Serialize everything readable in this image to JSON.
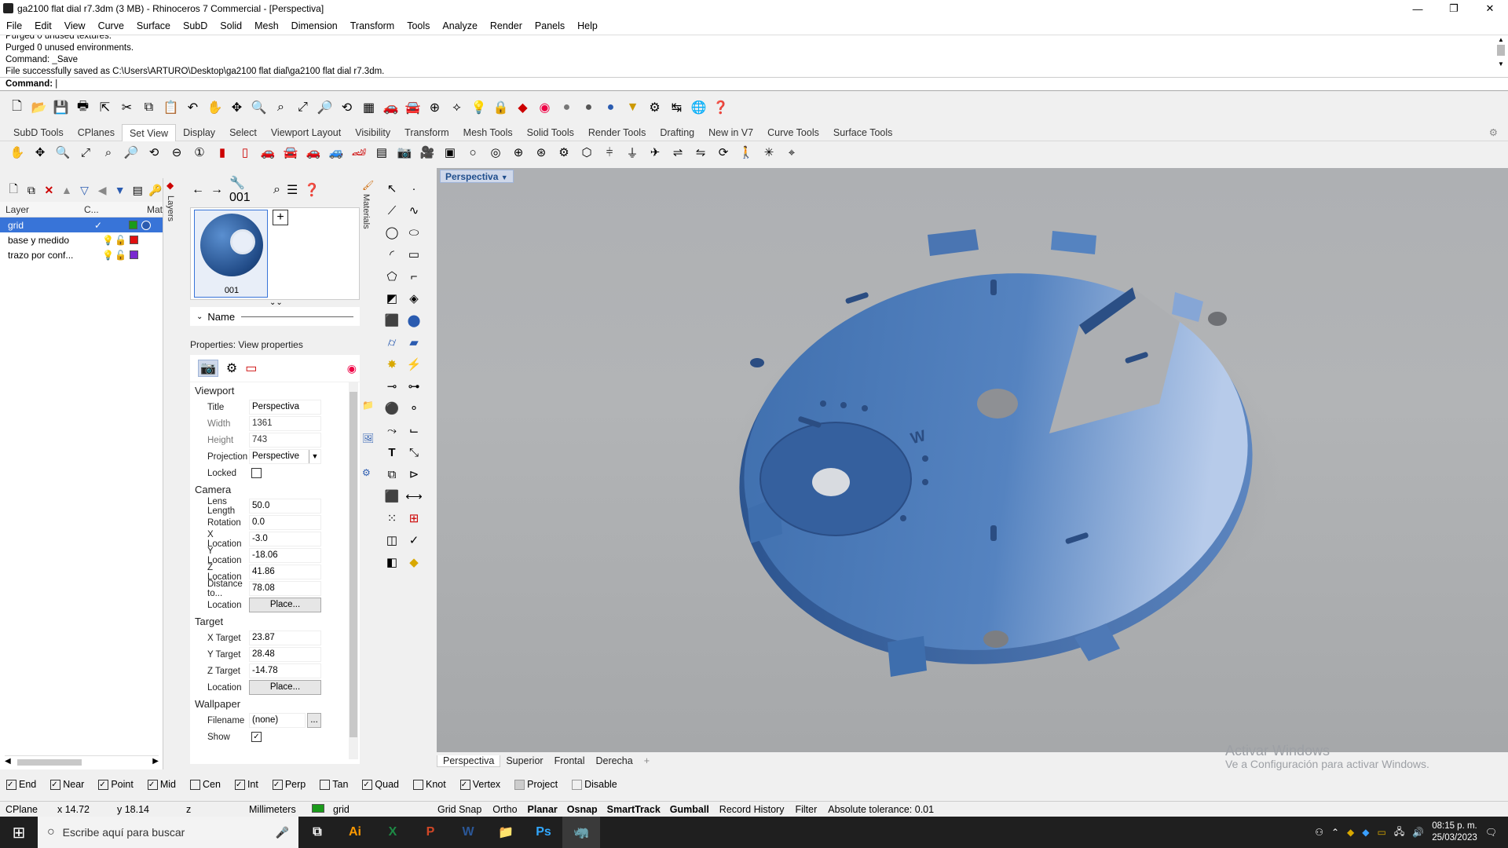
{
  "window": {
    "title": "ga2100 flat dial r7.3dm (3 MB) - Rhinoceros 7 Commercial - [Perspectiva]"
  },
  "menu": [
    "File",
    "Edit",
    "View",
    "Curve",
    "Surface",
    "SubD",
    "Solid",
    "Mesh",
    "Dimension",
    "Transform",
    "Tools",
    "Analyze",
    "Render",
    "Panels",
    "Help"
  ],
  "command_history": [
    "Purged 0 unused textures.",
    "Purged 0 unused environments.",
    "Command: _Save",
    "File successfully saved as C:\\Users\\ARTURO\\Desktop\\ga2100 flat dial\\ga2100 flat dial r7.3dm."
  ],
  "command_prompt": "Command:",
  "toolbar_tabs": [
    "SubD Tools",
    "CPlanes",
    "Set View",
    "Display",
    "Select",
    "Viewport Layout",
    "Visibility",
    "Transform",
    "Mesh Tools",
    "Solid Tools",
    "Render Tools",
    "Drafting",
    "New in V7",
    "Curve Tools",
    "Surface Tools"
  ],
  "active_toolbar_tab": "Set View",
  "layers": {
    "columns": [
      "Layer",
      "C...",
      "Mat"
    ],
    "rows": [
      {
        "name": "grid",
        "current": "✓",
        "color": "#1a9a1a",
        "selected": true
      },
      {
        "name": "base y medido",
        "current": "",
        "color": "#e01010",
        "selected": false
      },
      {
        "name": "trazo por conf...",
        "current": "",
        "color": "#7a2ad0",
        "selected": false
      }
    ]
  },
  "side_tabs": {
    "layers": "Layers",
    "materials": "Materials"
  },
  "materials": {
    "search_value": "001",
    "item_label": "001",
    "name_header": "Name"
  },
  "properties": {
    "title": "Properties: View properties",
    "sections": {
      "viewport": {
        "label": "Viewport",
        "title_k": "Title",
        "title_v": "Perspectiva",
        "width_k": "Width",
        "width_v": "1361",
        "height_k": "Height",
        "height_v": "743",
        "projection_k": "Projection",
        "projection_v": "Perspective",
        "locked_k": "Locked"
      },
      "camera": {
        "label": "Camera",
        "lens_k": "Lens Length",
        "lens_v": "50.0",
        "rotation_k": "Rotation",
        "rotation_v": "0.0",
        "xloc_k": "X Location",
        "xloc_v": "-3.0",
        "yloc_k": "Y Location",
        "yloc_v": "-18.06",
        "zloc_k": "Z Location",
        "zloc_v": "41.86",
        "dist_k": "Distance to...",
        "dist_v": "78.08",
        "loc_k": "Location",
        "loc_btn": "Place..."
      },
      "target": {
        "label": "Target",
        "xt_k": "X Target",
        "xt_v": "23.87",
        "yt_k": "Y Target",
        "yt_v": "28.48",
        "zt_k": "Z Target",
        "zt_v": "-14.78",
        "loc_k": "Location",
        "loc_btn": "Place..."
      },
      "wallpaper": {
        "label": "Wallpaper",
        "file_k": "Filename",
        "file_v": "(none)",
        "file_btn": "...",
        "show_k": "Show"
      }
    }
  },
  "viewport": {
    "active_label": "Perspectiva"
  },
  "viewport_tabs": [
    "Perspectiva",
    "Superior",
    "Frontal",
    "Derecha"
  ],
  "viewport_add": "+",
  "watermark": {
    "line1": "Activar Windows",
    "line2": "Ve a Configuración para activar Windows."
  },
  "osnaps": [
    {
      "label": "End",
      "checked": true
    },
    {
      "label": "Near",
      "checked": true
    },
    {
      "label": "Point",
      "checked": true
    },
    {
      "label": "Mid",
      "checked": true
    },
    {
      "label": "Cen",
      "checked": false
    },
    {
      "label": "Int",
      "checked": true
    },
    {
      "label": "Perp",
      "checked": true
    },
    {
      "label": "Tan",
      "checked": false
    },
    {
      "label": "Quad",
      "checked": true
    },
    {
      "label": "Knot",
      "checked": false
    },
    {
      "label": "Vertex",
      "checked": true
    },
    {
      "label": "Project",
      "checked": false
    },
    {
      "label": "Disable",
      "checked": false
    }
  ],
  "status": {
    "cplane": "CPlane",
    "x": "x 14.72",
    "y": "y 18.14",
    "z": "z",
    "units": "Millimeters",
    "layer": "grid",
    "grid_snap": "Grid Snap",
    "ortho": "Ortho",
    "planar": "Planar",
    "osnap": "Osnap",
    "smarttrack": "SmartTrack",
    "gumball": "Gumball",
    "record_history": "Record History",
    "filter": "Filter",
    "tolerance": "Absolute tolerance: 0.01"
  },
  "taskbar": {
    "search_placeholder": "Escribe aquí para buscar",
    "time": "08:15 p. m.",
    "date": "25/03/2023"
  }
}
